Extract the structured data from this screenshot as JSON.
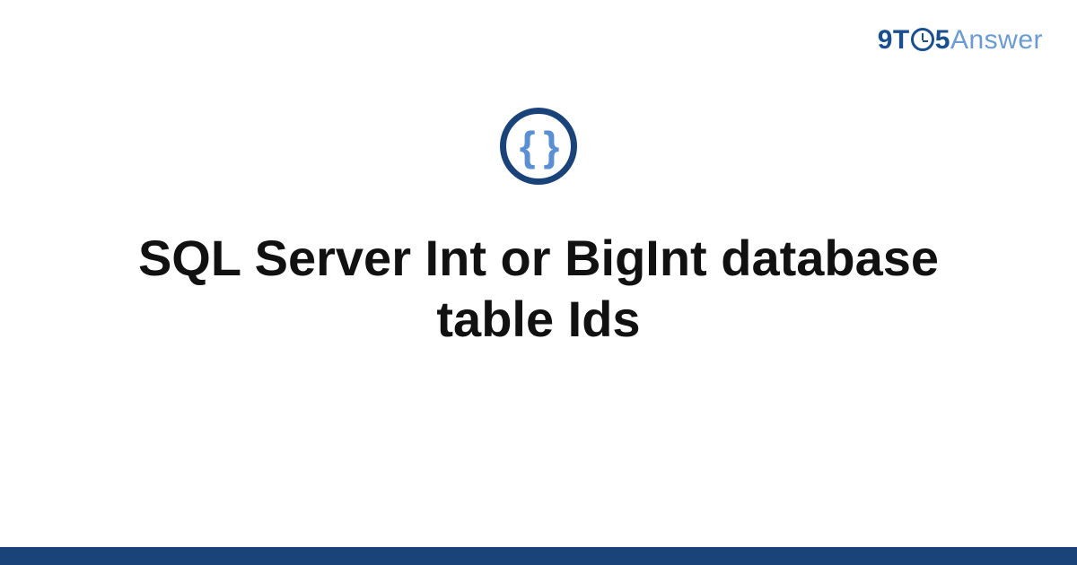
{
  "logo": {
    "part1": "9T",
    "part2": "5",
    "part3": "Answer"
  },
  "badge": {
    "glyph": "{ }"
  },
  "title": "SQL Server Int or BigInt database table Ids",
  "colors": {
    "brand_dark": "#1a4479",
    "brand_mid": "#1a4f8f",
    "brand_light": "#6b9bd1",
    "brace": "#5a8fd4"
  }
}
